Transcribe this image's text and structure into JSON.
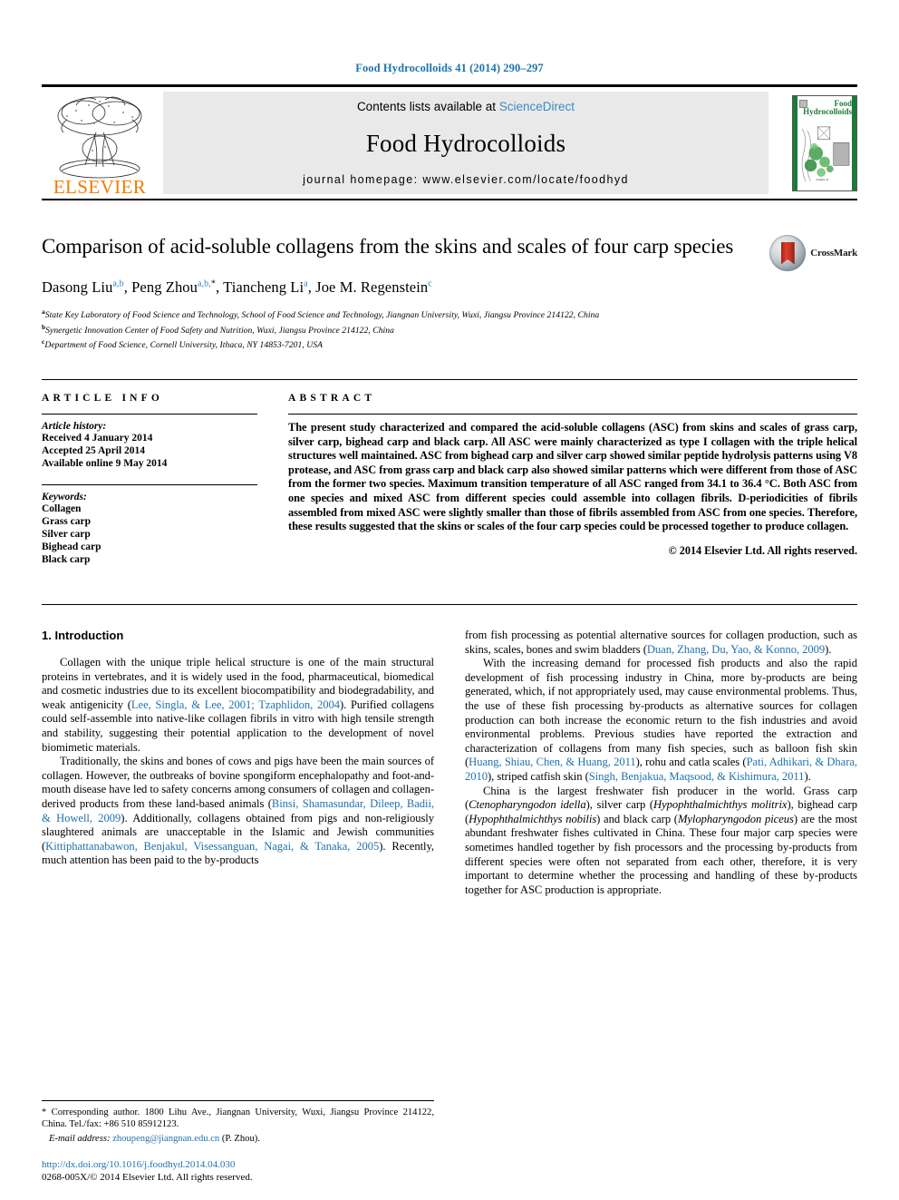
{
  "running_head": "Food Hydrocolloids 41 (2014) 290–297",
  "banner": {
    "publisher": "ELSEVIER",
    "contents_prefix": "Contents lists available at ",
    "sciencedirect": "ScienceDirect",
    "journal_name": "Food Hydrocolloids",
    "homepage": "journal homepage: www.elsevier.com/locate/foodhyd",
    "cover_title_line1": "Food",
    "cover_title_line2": "Hydrocolloids"
  },
  "article": {
    "title": "Comparison of acid-soluble collagens from the skins and scales of four carp species",
    "crossmark_label": "CrossMark",
    "authors": [
      {
        "name": "Dasong Liu",
        "sup": "a,b"
      },
      {
        "name": "Peng Zhou",
        "sup": "a,b,"
      },
      {
        "name": "Tiancheng Li",
        "sup": "a"
      },
      {
        "name": "Joe M. Regenstein",
        "sup": "c"
      }
    ],
    "affiliations": [
      {
        "mark": "a",
        "text": "State Key Laboratory of Food Science and Technology, School of Food Science and Technology, Jiangnan University, Wuxi, Jiangsu Province 214122, China"
      },
      {
        "mark": "b",
        "text": "Synergetic Innovation Center of Food Safety and Nutrition, Wuxi, Jiangsu Province 214122, China"
      },
      {
        "mark": "c",
        "text": "Department of Food Science, Cornell University, Ithaca, NY 14853-7201, USA"
      }
    ]
  },
  "article_info": {
    "heading": "ARTICLE INFO",
    "history_label": "Article history:",
    "history": [
      "Received 4 January 2014",
      "Accepted 25 April 2014",
      "Available online 9 May 2014"
    ],
    "keywords_label": "Keywords:",
    "keywords": [
      "Collagen",
      "Grass carp",
      "Silver carp",
      "Bighead carp",
      "Black carp"
    ]
  },
  "abstract": {
    "heading": "ABSTRACT",
    "text": "The present study characterized and compared the acid-soluble collagens (ASC) from skins and scales of grass carp, silver carp, bighead carp and black carp. All ASC were mainly characterized as type I collagen with the triple helical structures well maintained. ASC from bighead carp and silver carp showed similar peptide hydrolysis patterns using V8 protease, and ASC from grass carp and black carp also showed similar patterns which were different from those of ASC from the former two species. Maximum transition temperature of all ASC ranged from 34.1 to 36.4 °C. Both ASC from one species and mixed ASC from different species could assemble into collagen fibrils. D-periodicities of fibrils assembled from mixed ASC were slightly smaller than those of fibrils assembled from ASC from one species. Therefore, these results suggested that the skins or scales of the four carp species could be processed together to produce collagen.",
    "copyright": "© 2014 Elsevier Ltd. All rights reserved."
  },
  "introduction": {
    "heading": "1. Introduction",
    "left": {
      "p1_a": "Collagen with the unique triple helical structure is one of the main structural proteins in vertebrates, and it is widely used in the food, pharmaceutical, biomedical and cosmetic industries due to its excellent biocompatibility and biodegradability, and weak antigenicity (",
      "p1_cite1": "Lee, Singla, & Lee, 2001; Tzaphlidon, 2004",
      "p1_b": "). Purified collagens could self-assemble into native-like collagen fibrils in vitro with high tensile strength and stability, suggesting their potential application to the development of novel biomimetic materials.",
      "p2_a": "Traditionally, the skins and bones of cows and pigs have been the main sources of collagen. However, the outbreaks of bovine spongiform encephalopathy and foot-and-mouth disease have led to safety concerns among consumers of collagen and collagen-derived products from these land-based animals (",
      "p2_cite1": "Binsi, Shamasundar, Dileep, Badii, & Howell, 2009",
      "p2_b": "). Additionally, collagens obtained from pigs and non-religiously slaughtered animals are unacceptable in the Islamic and Jewish communities (",
      "p2_cite2": "Kittiphattanabawon, Benjakul, Visessanguan, Nagai, & Tanaka, 2005",
      "p2_c": "). Recently, much attention has been paid to the by-products"
    },
    "right": {
      "p2_cont_a": "from fish processing as potential alternative sources for collagen production, such as skins, scales, bones and swim bladders (",
      "p2_cont_cite": "Duan, Zhang, Du, Yao, & Konno, 2009",
      "p2_cont_b": ").",
      "p3_a": "With the increasing demand for processed fish products and also the rapid development of fish processing industry in China, more by-products are being generated, which, if not appropriately used, may cause environmental problems. Thus, the use of these fish processing by-products as alternative sources for collagen production can both increase the economic return to the fish industries and avoid environmental problems. Previous studies have reported the extraction and characterization of collagens from many fish species, such as balloon fish skin (",
      "p3_cite1": "Huang, Shiau, Chen, & Huang, 2011",
      "p3_b": "), rohu and catla scales (",
      "p3_cite2": "Pati, Adhikari, & Dhara, 2010",
      "p3_c": "), striped catfish skin (",
      "p3_cite3": "Singh, Benjakua, Maqsood, & Kishimura, 2011",
      "p3_d": ").",
      "p4_a": "China is the largest freshwater fish producer in the world. Grass carp (",
      "p4_sp1": "Ctenopharyngodon idella",
      "p4_b": "), silver carp (",
      "p4_sp2": "Hypophthalmichthys molitrix",
      "p4_c": "), bighead carp (",
      "p4_sp3": "Hypophthalmichthys nobilis",
      "p4_d": ") and black carp (",
      "p4_sp4": "Mylopharyngodon piceus",
      "p4_e": ") are the most abundant freshwater fishes cultivated in China. These four major carp species were sometimes handled together by fish processors and the processing by-products from different species were often not separated from each other, therefore, it is very important to determine whether the processing and handling of these by-products together for ASC production is appropriate."
    }
  },
  "footnote": {
    "corresponding": "* Corresponding author. 1800 Lihu Ave., Jiangnan University, Wuxi, Jiangsu Province 214122, China. Tel./fax: +86 510 85912123.",
    "email_label": "E-mail address:",
    "email": "zhoupeng@jiangnan.edu.cn",
    "email_suffix": "(P. Zhou).",
    "doi": "http://dx.doi.org/10.1016/j.foodhyd.2014.04.030",
    "issn": "0268-005X/© 2014 Elsevier Ltd. All rights reserved."
  },
  "colors": {
    "link": "#2072ae",
    "running_head": "#1c75a8",
    "elsevier_orange": "#f07c00",
    "cover_green": "#1d7a3c"
  }
}
